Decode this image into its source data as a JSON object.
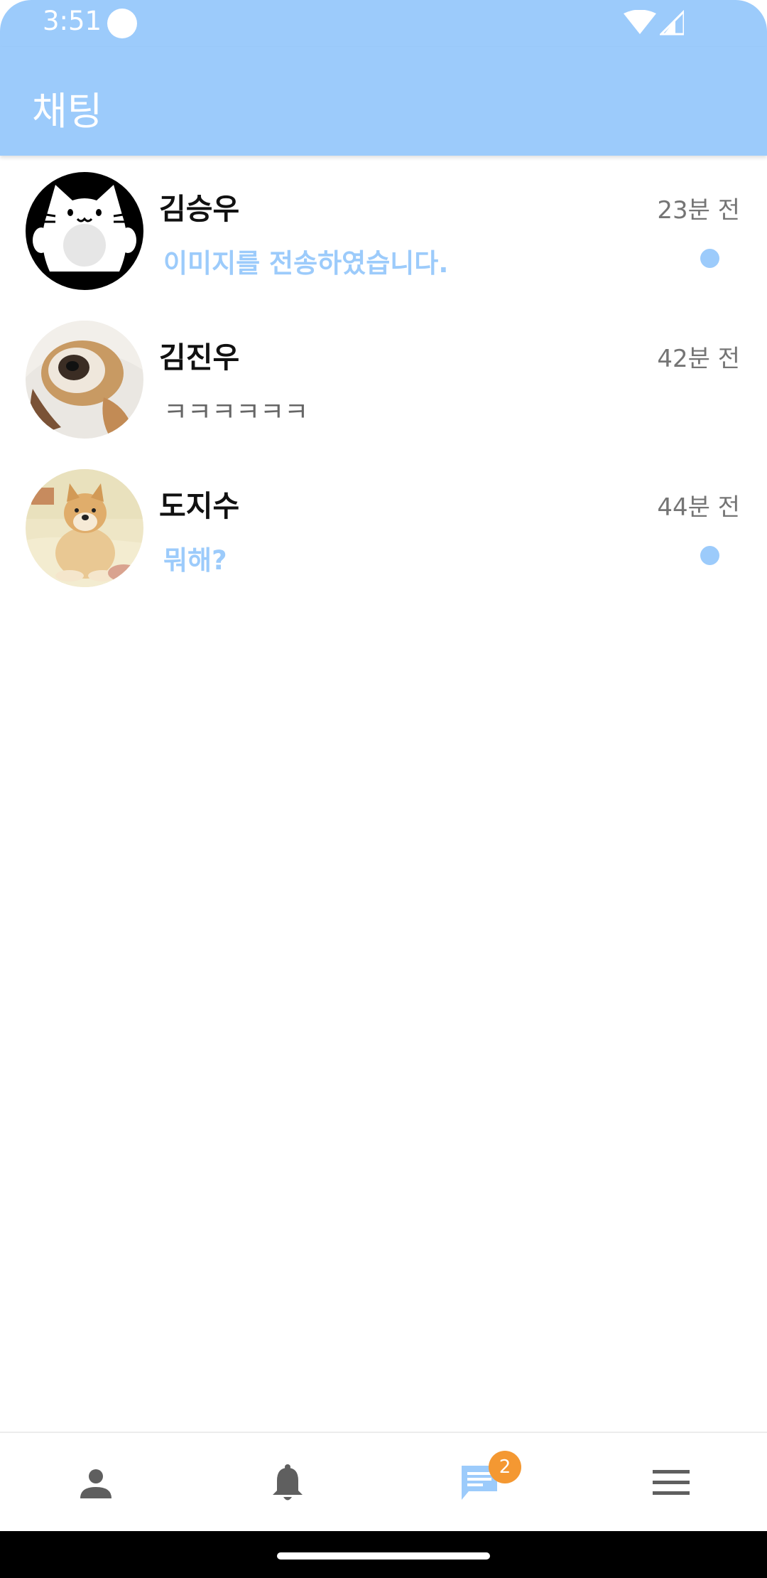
{
  "status_bar": {
    "time": "3:51"
  },
  "app_bar": {
    "title": "채팅"
  },
  "chats": [
    {
      "name": "김승우",
      "time": "23분 전",
      "message": "이미지를 전송하였습니다.",
      "unread": true,
      "avatar": "cat-avatar"
    },
    {
      "name": "김진우",
      "time": "42분 전",
      "message": "ㅋㅋㅋㅋㅋㅋ",
      "unread": false,
      "avatar": "dog-photo-avatar"
    },
    {
      "name": "도지수",
      "time": "44분 전",
      "message": "뭐해?",
      "unread": true,
      "avatar": "shiba-photo-avatar"
    }
  ],
  "bottom_nav": {
    "items": [
      {
        "icon": "person-icon",
        "active": false
      },
      {
        "icon": "bell-icon",
        "active": false
      },
      {
        "icon": "chat-icon",
        "active": true,
        "badge": "2"
      },
      {
        "icon": "menu-icon",
        "active": false
      }
    ]
  },
  "colors": {
    "primary": "#9ccbfb",
    "badge": "#f49832",
    "icon_inactive": "#5f5f5f"
  }
}
